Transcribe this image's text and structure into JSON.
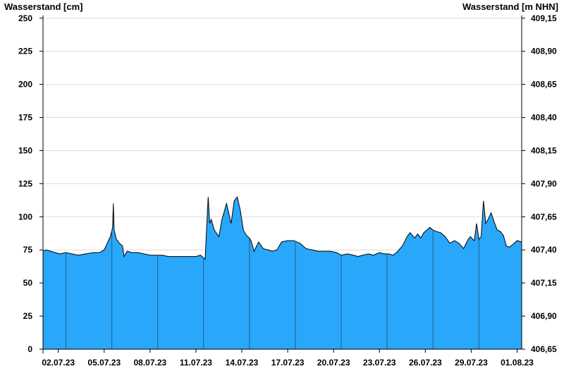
{
  "chart_data": {
    "type": "area",
    "ylabel_left": "Wasserstand [cm]",
    "ylabel_right": "Wasserstand [m NHN]",
    "ylim": [
      0,
      252
    ],
    "yticks_left": [
      {
        "v": 0,
        "label": "0"
      },
      {
        "v": 25,
        "label": "25"
      },
      {
        "v": 50,
        "label": "50"
      },
      {
        "v": 75,
        "label": "75"
      },
      {
        "v": 100,
        "label": "100"
      },
      {
        "v": 125,
        "label": "125"
      },
      {
        "v": 150,
        "label": "150"
      },
      {
        "v": 175,
        "label": "175"
      },
      {
        "v": 200,
        "label": "200"
      },
      {
        "v": 225,
        "label": "225"
      },
      {
        "v": 250,
        "label": "250"
      }
    ],
    "yticks_right": [
      {
        "v": 0,
        "label": "406,65"
      },
      {
        "v": 25,
        "label": "406,90"
      },
      {
        "v": 50,
        "label": "407,15"
      },
      {
        "v": 75,
        "label": "407,40"
      },
      {
        "v": 100,
        "label": "407,65"
      },
      {
        "v": 125,
        "label": "407,90"
      },
      {
        "v": 150,
        "label": "408,15"
      },
      {
        "v": 175,
        "label": "408,40"
      },
      {
        "v": 200,
        "label": "408,65"
      },
      {
        "v": 225,
        "label": "408,90"
      },
      {
        "v": 250,
        "label": "409,15"
      }
    ],
    "xlim": [
      1.0,
      32.3
    ],
    "xticks": [
      {
        "x": 2,
        "label": "02.07.23"
      },
      {
        "x": 5,
        "label": "05.07.23"
      },
      {
        "x": 8,
        "label": "08.07.23"
      },
      {
        "x": 11,
        "label": "11.07.23"
      },
      {
        "x": 14,
        "label": "14.07.23"
      },
      {
        "x": 17,
        "label": "17.07.23"
      },
      {
        "x": 20,
        "label": "20.07.23"
      },
      {
        "x": 23,
        "label": "23.07.23"
      },
      {
        "x": 26,
        "label": "26.07.23"
      },
      {
        "x": 29,
        "label": "29.07.23"
      },
      {
        "x": 32,
        "label": "01.08.23"
      }
    ],
    "grid": true,
    "fill_color": "#29a7fa",
    "line_color": "#000000",
    "series": [
      {
        "x": [
          1.0,
          1.2,
          1.5,
          1.8,
          2.1,
          2.5,
          2.9,
          3.3,
          3.8,
          4.3,
          4.7,
          5.0,
          5.2,
          5.4,
          5.55,
          5.6,
          5.65,
          5.8,
          6.0,
          6.2,
          6.3,
          6.5,
          6.8,
          7.2,
          7.6,
          8.0,
          8.4,
          8.8,
          9.2,
          9.6,
          10.0,
          10.5,
          11.0,
          11.3,
          11.6,
          11.8,
          11.9,
          12.0,
          12.2,
          12.5,
          12.7,
          13.0,
          13.2,
          13.3,
          13.5,
          13.7,
          13.9,
          14.1,
          14.3,
          14.5,
          14.6,
          14.8,
          15.1,
          15.4,
          15.7,
          16.0,
          16.3,
          16.6,
          17.0,
          17.4,
          17.8,
          18.2,
          18.6,
          19.0,
          19.4,
          19.8,
          20.2,
          20.5,
          20.9,
          21.3,
          21.6,
          21.9,
          22.3,
          22.6,
          23.0,
          23.3,
          23.6,
          23.9,
          24.2,
          24.5,
          24.8,
          25.0,
          25.3,
          25.5,
          25.7,
          25.9,
          26.1,
          26.3,
          26.5,
          26.7,
          27.0,
          27.3,
          27.6,
          27.9,
          28.2,
          28.5,
          28.8,
          28.95,
          29.1,
          29.2,
          29.35,
          29.5,
          29.65,
          29.8,
          29.95,
          30.1,
          30.3,
          30.5,
          30.7,
          30.9,
          31.1,
          31.3,
          31.5,
          31.8,
          32.0,
          32.3
        ],
        "y": [
          74,
          75,
          74,
          73,
          72,
          73,
          72,
          71,
          72,
          73,
          73,
          75,
          80,
          85,
          92,
          110,
          90,
          83,
          80,
          78,
          70,
          74,
          73,
          73,
          72,
          71,
          71,
          71,
          70,
          70,
          70,
          70,
          70,
          71,
          68,
          115,
          95,
          98,
          90,
          85,
          98,
          110,
          100,
          95,
          112,
          115,
          105,
          90,
          86,
          84,
          82,
          74,
          81,
          76,
          75,
          74,
          75,
          81,
          82,
          82,
          80,
          76,
          75,
          74,
          74,
          74,
          73,
          71,
          72,
          71,
          70,
          71,
          72,
          71,
          73,
          72,
          72,
          71,
          74,
          78,
          85,
          88,
          84,
          87,
          84,
          88,
          90,
          92,
          90,
          89,
          88,
          85,
          80,
          82,
          80,
          76,
          83,
          85,
          83,
          82,
          95,
          83,
          85,
          112,
          95,
          98,
          103,
          96,
          90,
          89,
          86,
          78,
          77,
          80,
          82,
          81
        ]
      }
    ]
  }
}
